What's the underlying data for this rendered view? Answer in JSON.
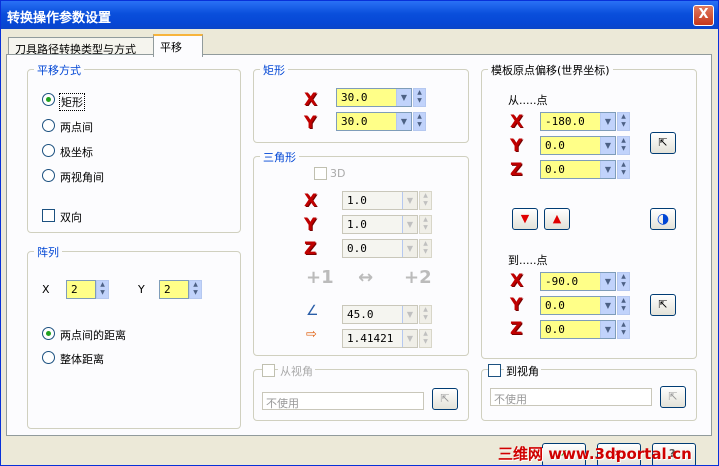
{
  "window": {
    "title": "转换操作参数设置",
    "close": "X"
  },
  "tabs": [
    "刀具路径转换类型与方式",
    "平移"
  ],
  "move_mode": {
    "title": "平移方式",
    "options": [
      "矩形",
      "两点间",
      "极坐标",
      "两视角间"
    ],
    "selected": 0,
    "bidirectional": "双向"
  },
  "array": {
    "title": "阵列",
    "x_label": "X",
    "x_value": "2",
    "y_label": "Y",
    "y_value": "2",
    "options": [
      "两点间的距离",
      "整体距离"
    ],
    "selected": 0
  },
  "rect": {
    "title": "矩形",
    "x_label": "X",
    "x_value": "30.0",
    "y_label": "Y",
    "y_value": "30.0"
  },
  "triangle": {
    "title": "三角形",
    "check_3d": "3D",
    "x_label": "X",
    "x_value": "1.0",
    "y_label": "Y",
    "y_value": "1.0",
    "z_label": "Z",
    "z_value": "0.0",
    "btn1": "+1",
    "btn_swap": "↔",
    "btn2": "+2",
    "angle_value": "45.0",
    "dist_value": "1.41421"
  },
  "from_view": {
    "label": "从视角",
    "field": "不使用"
  },
  "origin": {
    "title": "模板原点偏移(世界坐标)",
    "from_label": "从.....点",
    "fx": "-180.0",
    "fy": "0.0",
    "fz": "0.0",
    "to_label": "到.....点",
    "tx": "-90.0",
    "ty": "0.0",
    "tz": "0.0",
    "x_label": "X",
    "y_label": "Y",
    "z_label": "Z"
  },
  "to_view": {
    "label": "到视角",
    "field": "不使用"
  },
  "watermark": "三维网 www.3dportal.cn",
  "colors": {
    "accent": "#0046d5",
    "axis": "#c00000",
    "field": "#ffff88"
  }
}
